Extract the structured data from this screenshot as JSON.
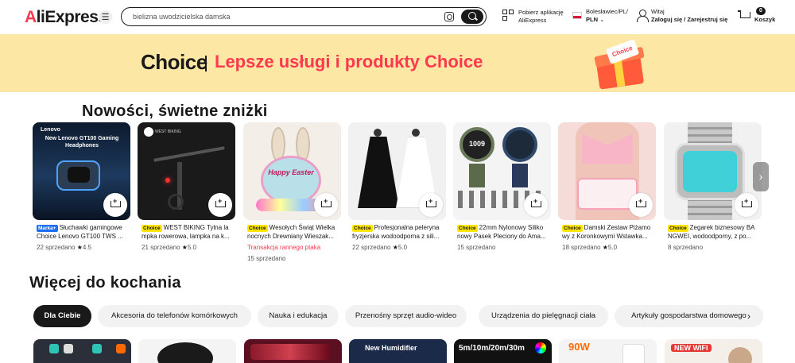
{
  "header": {
    "logo_text": "AliExpress",
    "search_value": "bielizna uwodzicielska damska",
    "app_line1": "Pobierz aplikację",
    "app_line2": "AliExpress",
    "locale_line1": "Bolesławiec/PL/",
    "locale_line2": "PLN",
    "login_line1": "Witaj",
    "login_line2": "Zaloguj się / Zarejestruj się",
    "cart_count": "0",
    "cart_label": "Koszyk"
  },
  "banner": {
    "choice_logo": "Choice",
    "text": "Lepsze usługi i produkty Choice",
    "gift_card_text": "Choice"
  },
  "section1": {
    "title": "Nowości, świetne zniżki"
  },
  "products": [
    {
      "tag": "Marka+",
      "tag_style": "blue",
      "title": "Słuchawki gamingowe Choice Lenovo GT100 TWS ...",
      "sold": "22 sprzedano",
      "rating": "4.5",
      "img_label": "New Lenovo GT100 Gaming Headphones"
    },
    {
      "tag": "Choice",
      "tag_style": "yellow",
      "title": "WEST BIKING Tylna la mpka rowerowa, lampka na k...",
      "sold": "21 sprzedano",
      "rating": "5.0",
      "img_label": "WEST BIKING"
    },
    {
      "tag": "Choice",
      "tag_style": "yellow",
      "title": "Wesołych Świąt Wielka nocnych Drewniany Wieszak...",
      "promo": "Transakcja rannego ptaka",
      "sold": "15 sprzedano",
      "img_label": "Happy Easter"
    },
    {
      "tag": "Choice",
      "tag_style": "yellow",
      "title": "Profesjonalna peleryna fryzjerska wodoodporna z sili...",
      "sold": "22 sprzedano",
      "rating": "5.0"
    },
    {
      "tag": "Choice",
      "tag_style": "yellow",
      "title": "22mm Nylonowy Siliko nowy Pasek Pleciony do Ama...",
      "sold": "15 sprzedano",
      "img_label": "1009"
    },
    {
      "tag": "Choice",
      "tag_style": "yellow",
      "title": "Damski Zestaw Piżamo wy z Koronkowymi Wstawka...",
      "sold": "18 sprzedano",
      "rating": "5.0"
    },
    {
      "tag": "Choice",
      "tag_style": "yellow",
      "title": "Zegarek biznesowy BA NGWEI, wodoodporny, z po...",
      "sold": "8 sprzedano"
    }
  ],
  "section2": {
    "title": "Więcej do kochania"
  },
  "categories": [
    "Dla Ciebie",
    "Akcesoria do telefonów komórkowych",
    "Nauka i edukacja",
    "Przenośny sprzęt audio-wideo",
    "Urządzenia do pielęgnacji ciała",
    "Artykuły gospodarstwa domowego"
  ],
  "bottom_row": [
    {
      "label": ""
    },
    {
      "label": ""
    },
    {
      "label": ""
    },
    {
      "label": "New Humidifier"
    },
    {
      "label": "5m/10m/20m/30m"
    },
    {
      "label": "90W"
    },
    {
      "label": "NEW WIFI"
    }
  ],
  "colors": {
    "brand_red": "#fd384f",
    "banner_bg": "#fde7a4",
    "choice_tag": "#ffe600",
    "brand_tag": "#1d6ff2"
  },
  "icons": [
    "menu-icon",
    "camera-search-icon",
    "search-icon",
    "qr-code-icon",
    "flag-pl-icon",
    "user-icon",
    "cart-icon",
    "add-to-cart-icon",
    "star-icon",
    "chevron-right-icon"
  ]
}
